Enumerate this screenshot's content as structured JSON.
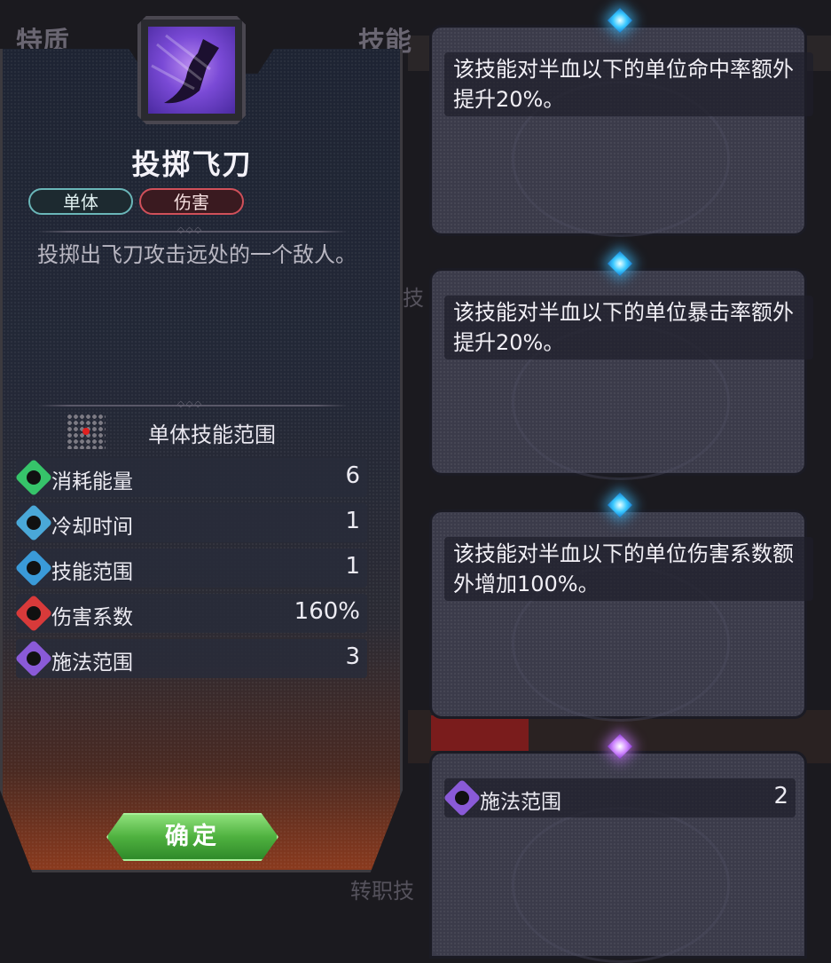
{
  "background": {
    "tab_traits": "特质",
    "tab_skills": "技能",
    "text_normal": "通技",
    "text_transfer": "转职技"
  },
  "skill": {
    "title": "投掷飞刀",
    "tags": [
      "单体",
      "伤害"
    ],
    "description": "投掷出飞刀攻击远处的一个敌人。",
    "range_label": "单体技能范围",
    "stats": [
      {
        "label": "消耗能量",
        "value": "6",
        "icon": "energy-icon",
        "color": "#36c46a"
      },
      {
        "label": "冷却时间",
        "value": "1",
        "icon": "cooldown-icon",
        "color": "#4aa8d8"
      },
      {
        "label": "技能范围",
        "value": "1",
        "icon": "skill-range-icon",
        "color": "#3a9ad8"
      },
      {
        "label": "伤害系数",
        "value": "160%",
        "icon": "damage-icon",
        "color": "#d83a3a"
      },
      {
        "label": "施法范围",
        "value": "3",
        "icon": "cast-range-icon",
        "color": "#8a5ad8"
      }
    ],
    "confirm_label": "确定"
  },
  "upgrades": [
    {
      "text": "该技能对半血以下的单位命中率额外提升20%。",
      "gem": "blue"
    },
    {
      "text": "该技能对半血以下的单位暴击率额外提升20%。",
      "gem": "blue"
    },
    {
      "text": "该技能对半血以下的单位伤害系数额外增加100%。",
      "gem": "blue"
    },
    {
      "label": "施法范围",
      "value": "2",
      "gem": "purple"
    }
  ]
}
